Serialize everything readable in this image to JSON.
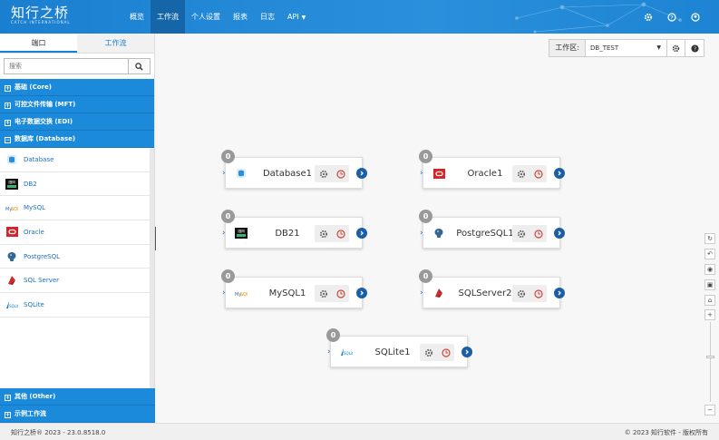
{
  "app": {
    "logo_cn": "知行之桥",
    "logo_en": "CATCH INTERNATIONAL"
  },
  "nav": {
    "items": [
      {
        "label": "概览",
        "active": false
      },
      {
        "label": "工作流",
        "active": true
      },
      {
        "label": "个人设置",
        "active": false
      },
      {
        "label": "报表",
        "active": false
      },
      {
        "label": "日志",
        "active": false
      },
      {
        "label": "API",
        "active": false,
        "dropdown": true
      }
    ]
  },
  "top_icons": [
    "gear-icon",
    "help-icon",
    "user-icon"
  ],
  "sidebar": {
    "tabs": [
      {
        "label": "端口",
        "active": true
      },
      {
        "label": "工作流",
        "active": false
      }
    ],
    "search_placeholder": "搜索",
    "groups_top": [
      {
        "label": "基础 (Core)",
        "sign": "+"
      },
      {
        "label": "可控文件传输 (MFT)",
        "sign": "+"
      },
      {
        "label": "电子数据交换 (EDI)",
        "sign": "+"
      },
      {
        "label": "数据库 (Database)",
        "sign": "−"
      }
    ],
    "items": [
      {
        "label": "Database",
        "icon": "database-icon"
      },
      {
        "label": "DB2",
        "icon": "db2-icon"
      },
      {
        "label": "MySQL",
        "icon": "mysql-icon"
      },
      {
        "label": "Oracle",
        "icon": "oracle-icon"
      },
      {
        "label": "PostgreSQL",
        "icon": "postgresql-icon"
      },
      {
        "label": "SQL Server",
        "icon": "sqlserver-icon"
      },
      {
        "label": "SQLite",
        "icon": "sqlite-icon"
      }
    ],
    "groups_bottom": [
      {
        "label": "其他 (Other)",
        "sign": "+"
      },
      {
        "label": "示例工作流",
        "sign": "+"
      }
    ]
  },
  "workspace": {
    "label": "工作区:",
    "value": "DB_TEST"
  },
  "nodes": [
    {
      "title": "Database1",
      "count": "0",
      "icon": "database-icon"
    },
    {
      "title": "Oracle1",
      "count": "0",
      "icon": "oracle-icon"
    },
    {
      "title": "DB21",
      "count": "0",
      "icon": "db2-icon"
    },
    {
      "title": "PostgreSQL1",
      "count": "0",
      "icon": "postgresql-icon"
    },
    {
      "title": "MySQL1",
      "count": "0",
      "icon": "mysql-icon"
    },
    {
      "title": "SQLServer2",
      "count": "0",
      "icon": "sqlserver-icon"
    },
    {
      "title": "SQLite1",
      "count": "0",
      "icon": "sqlite-icon"
    }
  ],
  "colors": {
    "primary": "#1b8adb",
    "nav_active": "#1565a9",
    "link": "#1b6fc4"
  },
  "footer": {
    "left": "知行之桥® 2023 - 23.0.8518.0",
    "right": "© 2023 知行软件 - 版权所有"
  }
}
